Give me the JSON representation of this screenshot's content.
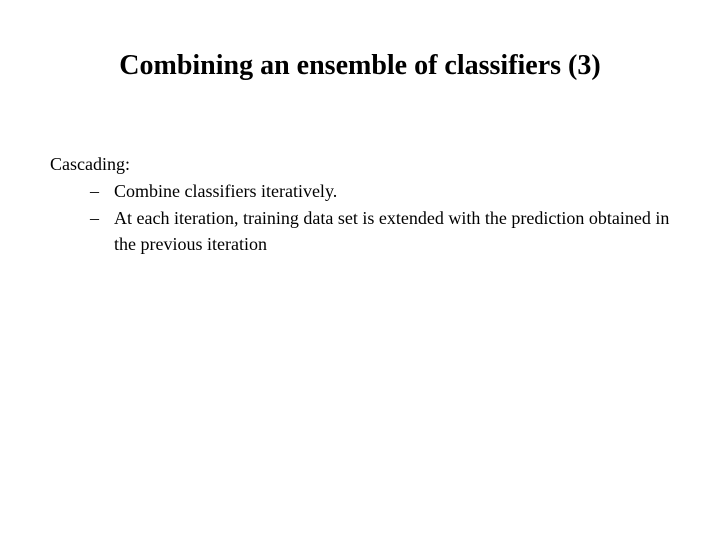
{
  "slide": {
    "title": "Combining an ensemble of  classifiers (3)",
    "section_heading": "Cascading:",
    "bullets": [
      "Combine classifiers iteratively.",
      "At each iteration, training data set is extended with the prediction obtained in the previous iteration"
    ]
  }
}
